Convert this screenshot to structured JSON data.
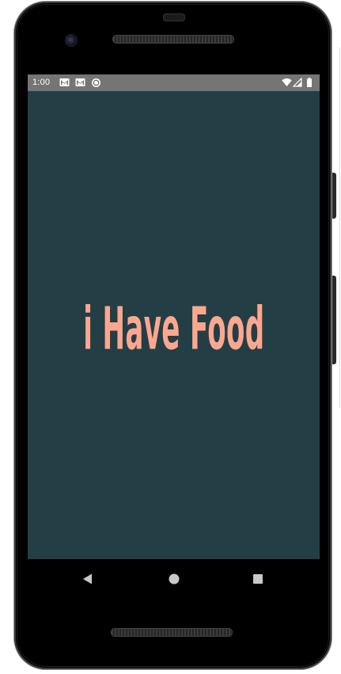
{
  "status_bar": {
    "time": "1:00",
    "icons": [
      "gmail-icon",
      "gmail-icon",
      "sync-icon",
      "wifi-icon",
      "cell-signal-icon",
      "battery-icon"
    ]
  },
  "app": {
    "title": "i Have Food",
    "colors": {
      "background": "#233f45",
      "title": "#fda78f",
      "status_bar": "#757575"
    }
  },
  "nav_bar": {
    "buttons": [
      "back-icon",
      "home-icon",
      "recents-icon"
    ]
  }
}
